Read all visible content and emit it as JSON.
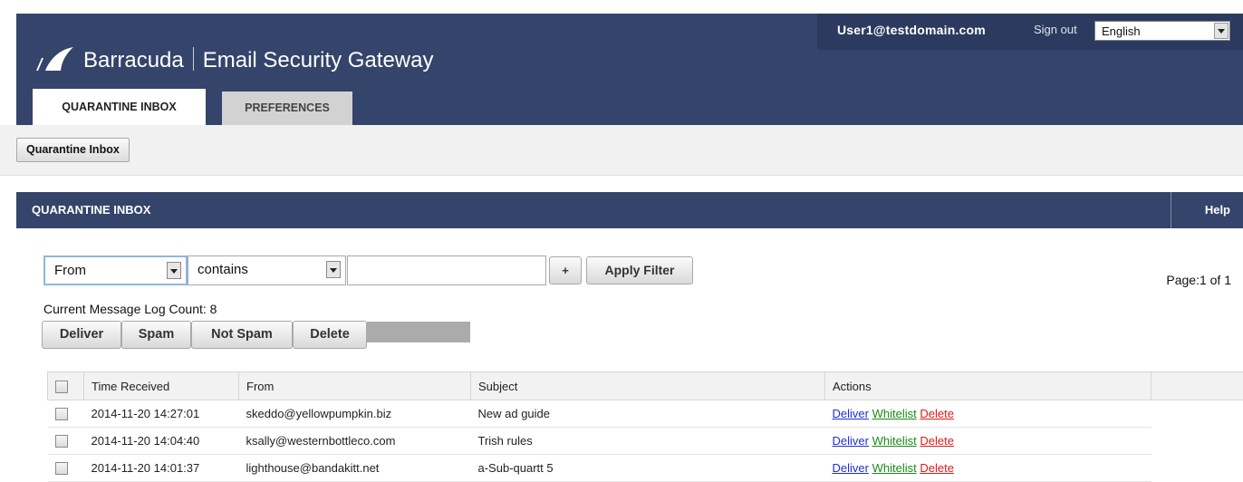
{
  "header": {
    "brand_name": "Barracuda",
    "product_name": "Email Security Gateway",
    "user_email": "User1@testdomain.com",
    "sign_out_label": "Sign out",
    "language_selected": "English",
    "tabs": [
      {
        "label": "QUARANTINE INBOX",
        "active": true
      },
      {
        "label": "PREFERENCES",
        "active": false
      }
    ]
  },
  "breadcrumb": {
    "label": "Quarantine Inbox"
  },
  "panel": {
    "title": "QUARANTINE INBOX",
    "help_label": "Help"
  },
  "filter": {
    "field_selected": "From",
    "operator_selected": "contains",
    "value": "",
    "add_label": "+",
    "apply_label": "Apply Filter"
  },
  "page_info": "Page:1 of 1",
  "log_count": "Current Message Log Count: 8",
  "action_buttons": {
    "deliver": "Deliver",
    "spam": "Spam",
    "not_spam": "Not Spam",
    "delete": "Delete"
  },
  "table": {
    "columns": [
      "Time Received",
      "From",
      "Subject",
      "Actions"
    ],
    "rows": [
      {
        "time": "2014-11-20 14:27:01",
        "from": "skeddo@yellowpumpkin.biz",
        "subject": "New ad guide"
      },
      {
        "time": "2014-11-20 14:04:40",
        "from": "ksally@westernbottleco.com",
        "subject": "Trish rules"
      },
      {
        "time": "2014-11-20 14:01:37",
        "from": "lighthouse@bandakitt.net",
        "subject": "a-Sub-quartt 5"
      }
    ],
    "row_actions": {
      "deliver": "Deliver",
      "whitelist": "Whitelist",
      "delete": "Delete"
    }
  },
  "colors": {
    "header_bg": "#34446b",
    "link_deliver": "#1f2fd4",
    "link_whitelist": "#1c8a1c",
    "link_delete": "#e01818"
  }
}
